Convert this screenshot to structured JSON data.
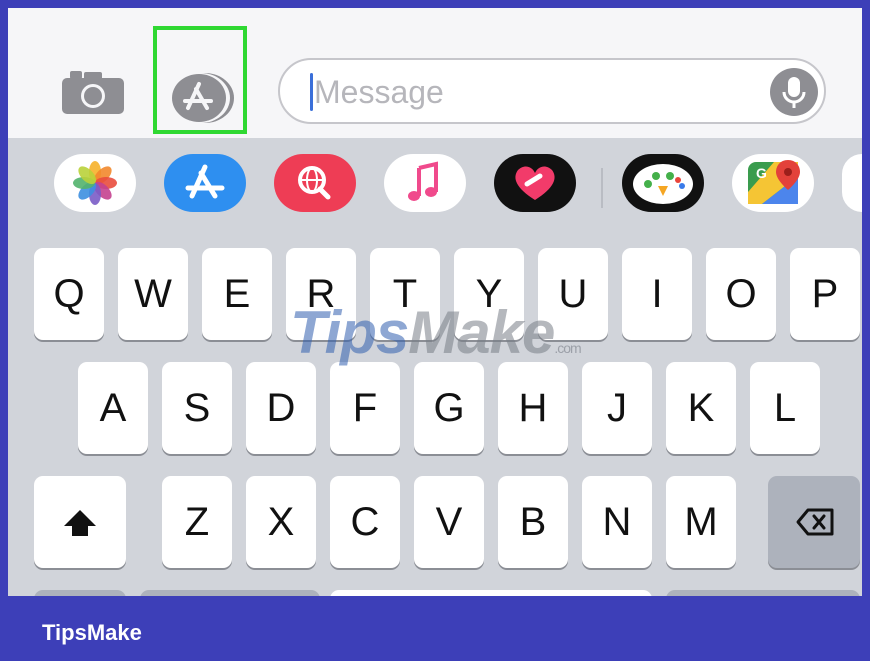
{
  "toolbar": {
    "message_placeholder": "Message"
  },
  "apps": [
    {
      "name": "photos-app-icon"
    },
    {
      "name": "app-store-icon"
    },
    {
      "name": "web-search-icon"
    },
    {
      "name": "music-icon"
    },
    {
      "name": "digital-touch-icon"
    },
    {
      "name": "game-app-icon"
    },
    {
      "name": "google-maps-icon"
    }
  ],
  "keyboard": {
    "row1": [
      "Q",
      "W",
      "E",
      "R",
      "T",
      "Y",
      "U",
      "I",
      "O",
      "P"
    ],
    "row2": [
      "A",
      "S",
      "D",
      "F",
      "G",
      "H",
      "J",
      "K",
      "L"
    ],
    "row3": [
      "Z",
      "X",
      "C",
      "V",
      "B",
      "N",
      "M"
    ]
  },
  "watermark": {
    "brand_a": "Tips",
    "brand_b": "Make",
    "domain": ".com"
  },
  "footer": {
    "brand": "TipsMake"
  },
  "colors": {
    "highlight": "#2fd832",
    "border": "#3d3fb8"
  }
}
